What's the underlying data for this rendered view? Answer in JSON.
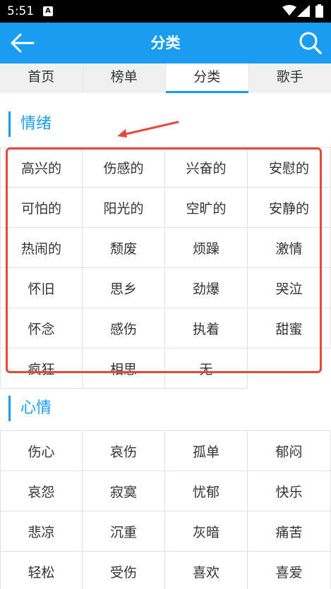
{
  "status_bar": {
    "time": "5:51",
    "notification_glyph": "A"
  },
  "app_bar": {
    "title": "分类",
    "back_icon": "arrow-left-icon",
    "search_icon": "search-icon"
  },
  "tabs": [
    {
      "label": "首页",
      "active": false
    },
    {
      "label": "榜单",
      "active": false
    },
    {
      "label": "分类",
      "active": true
    },
    {
      "label": "歌手",
      "active": false
    }
  ],
  "sections": [
    {
      "title": "情绪",
      "items": [
        "高兴的",
        "伤感的",
        "兴奋的",
        "安慰的",
        "可怕的",
        "阳光的",
        "空旷的",
        "安静的",
        "热闹的",
        "颓废",
        "烦躁",
        "激情",
        "怀旧",
        "思乡",
        "劲爆",
        "哭泣",
        "怀念",
        "感伤",
        "执着",
        "甜蜜",
        "疯狂",
        "相思",
        "无"
      ]
    },
    {
      "title": "心情",
      "items": [
        "伤心",
        "哀伤",
        "孤单",
        "郁闷",
        "哀怨",
        "寂寞",
        "忧郁",
        "快乐",
        "悲凉",
        "沉重",
        "灰暗",
        "痛苦",
        "轻松",
        "受伤",
        "喜欢",
        "喜爱"
      ]
    }
  ],
  "colors": {
    "brand": "#1a9df0",
    "annotation": "#e24a3b"
  }
}
